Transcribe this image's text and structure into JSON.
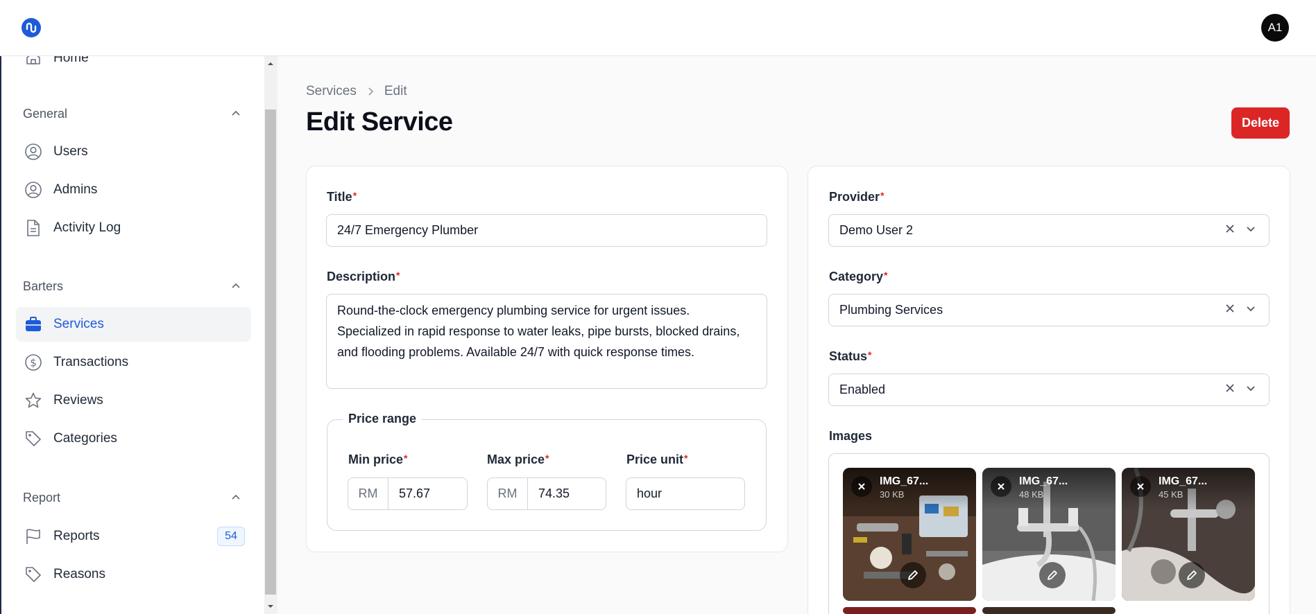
{
  "header": {
    "avatar_initials": "A1"
  },
  "sidebar": {
    "home_label": "Home",
    "groups": [
      {
        "label": "General",
        "items": [
          {
            "label": "Users"
          },
          {
            "label": "Admins"
          },
          {
            "label": "Activity Log"
          }
        ]
      },
      {
        "label": "Barters",
        "items": [
          {
            "label": "Services"
          },
          {
            "label": "Transactions"
          },
          {
            "label": "Reviews"
          },
          {
            "label": "Categories"
          }
        ]
      },
      {
        "label": "Report",
        "items": [
          {
            "label": "Reports",
            "badge": "54"
          },
          {
            "label": "Reasons"
          }
        ]
      }
    ],
    "active_item": "Services"
  },
  "breadcrumb": {
    "parent": "Services",
    "current": "Edit"
  },
  "page": {
    "title": "Edit Service",
    "delete_label": "Delete"
  },
  "form": {
    "required_mark": "*",
    "title": {
      "label": "Title",
      "value": "24/7 Emergency Plumber"
    },
    "description": {
      "label": "Description",
      "value": "Round-the-clock emergency plumbing service for urgent issues. Specialized in rapid response to water leaks, pipe bursts, blocked drains, and flooding problems. Available 24/7 with quick response times."
    },
    "price_range": {
      "legend": "Price range",
      "min": {
        "label": "Min price",
        "prefix": "RM",
        "value": "57.67"
      },
      "max": {
        "label": "Max price",
        "prefix": "RM",
        "value": "74.35"
      },
      "unit": {
        "label": "Price unit",
        "value": "hour"
      }
    },
    "provider": {
      "label": "Provider",
      "value": "Demo User 2"
    },
    "category": {
      "label": "Category",
      "value": "Plumbing Services"
    },
    "status": {
      "label": "Status",
      "value": "Enabled"
    },
    "images": {
      "label": "Images",
      "files": [
        {
          "name": "IMG_67...",
          "size": "30 KB"
        },
        {
          "name": "IMG_67...",
          "size": "48 KB"
        },
        {
          "name": "IMG_67...",
          "size": "45 KB"
        }
      ]
    }
  },
  "colors": {
    "accent": "#1e5bd8",
    "danger": "#dc2626",
    "required": "#dc2626"
  }
}
